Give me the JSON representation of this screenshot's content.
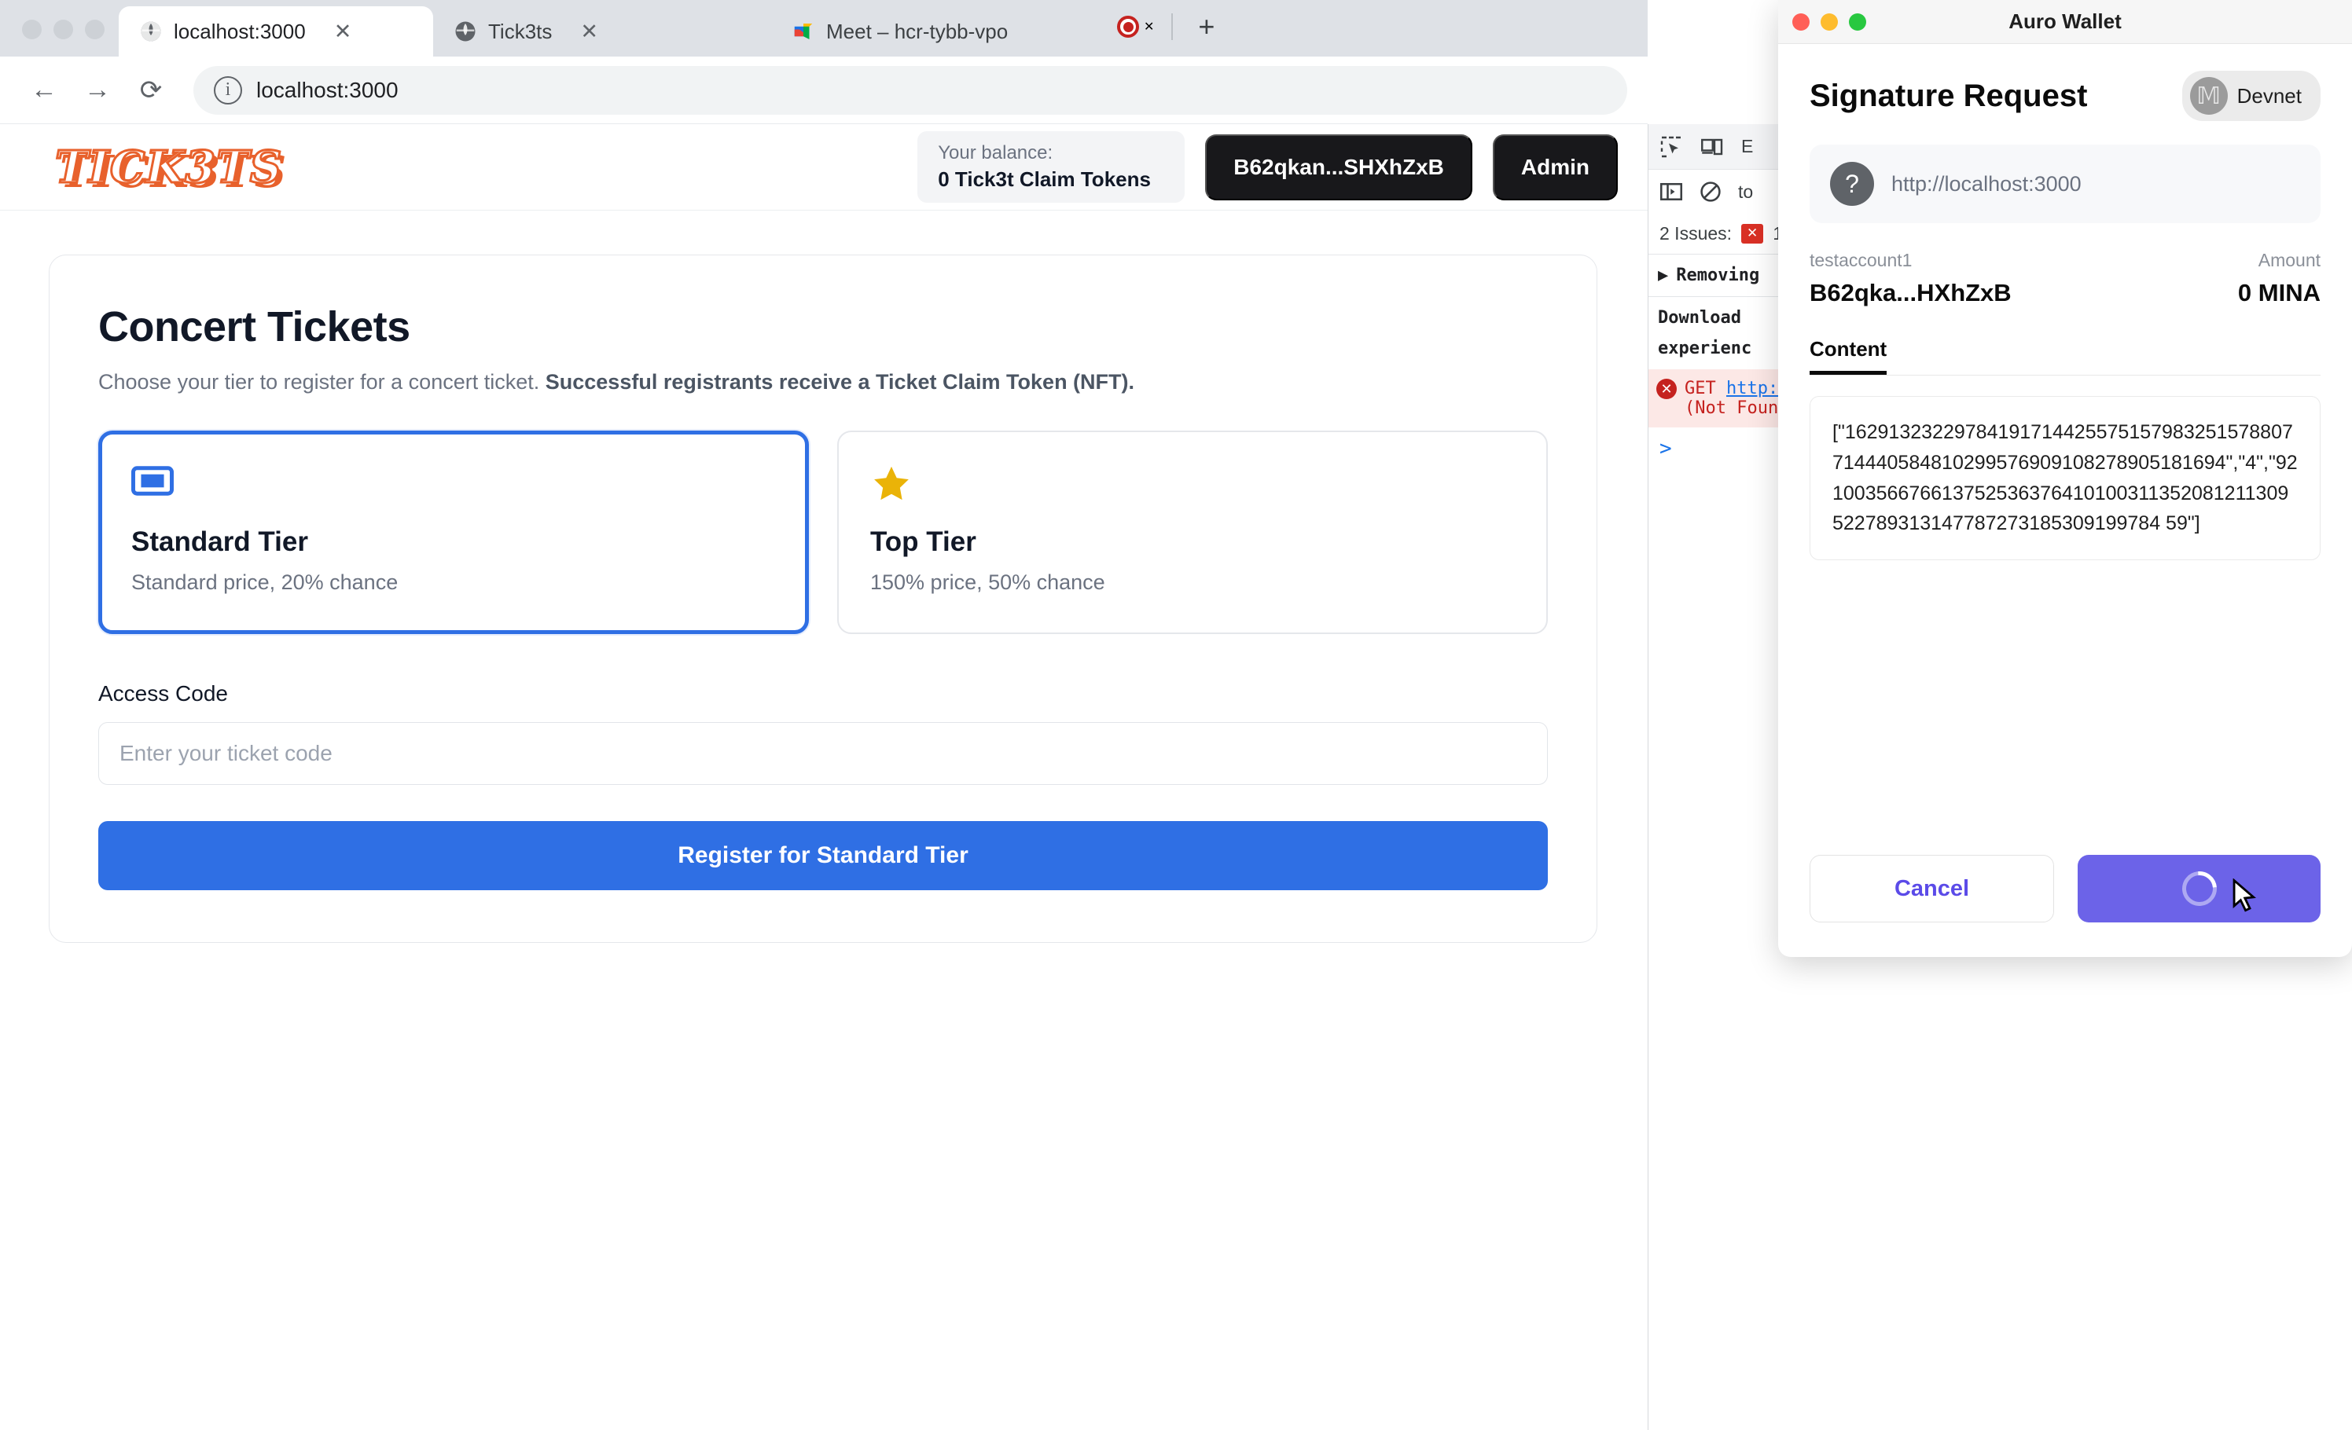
{
  "browser": {
    "tabs": [
      {
        "title": "localhost:3000",
        "icon": "globe-icon",
        "active": true,
        "close": "✕"
      },
      {
        "title": "Tick3ts",
        "icon": "globe-icon",
        "active": false,
        "close": "✕"
      },
      {
        "title": "Meet – hcr-tybb-vpo",
        "icon": "meet-icon",
        "active": false,
        "close": "✕",
        "recording": true
      }
    ],
    "new_tab_label": "+",
    "toolbar": {
      "back": "←",
      "forward": "→",
      "reload": "⟳",
      "info_icon": "ⓘ",
      "url": "localhost:3000"
    }
  },
  "app": {
    "logo": "TICK3TS",
    "balance_label": "Your balance:",
    "balance_value": "0 Tick3t Claim Tokens",
    "account_button": "B62qkan...SHXhZxB",
    "admin_button": "Admin",
    "card": {
      "title": "Concert Tickets",
      "subtitle_plain": "Choose your tier to register for a concert ticket. ",
      "subtitle_bold": "Successful registrants receive a Ticket Claim Token (NFT).",
      "tiers": [
        {
          "icon": "ticket-icon",
          "name": "Standard Tier",
          "desc": "Standard price, 20% chance",
          "selected": true
        },
        {
          "icon": "star-icon",
          "name": "Top Tier",
          "desc": "150% price, 50% chance",
          "selected": false
        }
      ],
      "access_code_label": "Access Code",
      "access_code_value": "",
      "access_code_placeholder": "Enter your ticket code",
      "register_button": "Register for Standard Tier"
    }
  },
  "devtools": {
    "inspect_icon": "inspect-element-icon",
    "device_icon": "device-toolbar-icon",
    "elements_tab": "E",
    "sidebar_icon": "console-sidebar-icon",
    "clear_icon": "clear-console-icon",
    "filter_text": "to",
    "issues_label": "2 Issues:",
    "issues_count": "1",
    "log_expand": "▶",
    "log_line1": "Removing",
    "log_line2": "Download",
    "log_line3": "experienc",
    "error_method": "GET",
    "error_url": "http:",
    "error_status": "(Not Foun",
    "prompt": ">"
  },
  "wallet": {
    "window_title": "Auro Wallet",
    "traffic": {
      "close": "#ff5f57",
      "minimize": "#febc2e",
      "zoom": "#28c840"
    },
    "heading": "Signature Request",
    "network": "Devnet",
    "network_logo": "mina-logo-icon",
    "origin_icon": "unknown-site-icon",
    "origin_url": "http://localhost:3000",
    "account_label": "testaccount1",
    "account_address": "B62qka...HXhZxB",
    "amount_label": "Amount",
    "amount_value": "0 MINA",
    "content_tab": "Content",
    "content_value": "[\"16291323229784191714425575157983251578807714440584810299576909108278905181694\",\"4\",\"92100356676613752536376410100311352081211309522789313147787273185309199784 59\"]",
    "cancel_button": "Cancel",
    "confirm_button_state": "loading-spinner"
  },
  "colors": {
    "accent_blue": "#2f6fe4",
    "brand_orange": "#e8612c",
    "wallet_purple": "#6c63e8",
    "star_gold": "#eab308",
    "error_red": "#c5221f"
  }
}
